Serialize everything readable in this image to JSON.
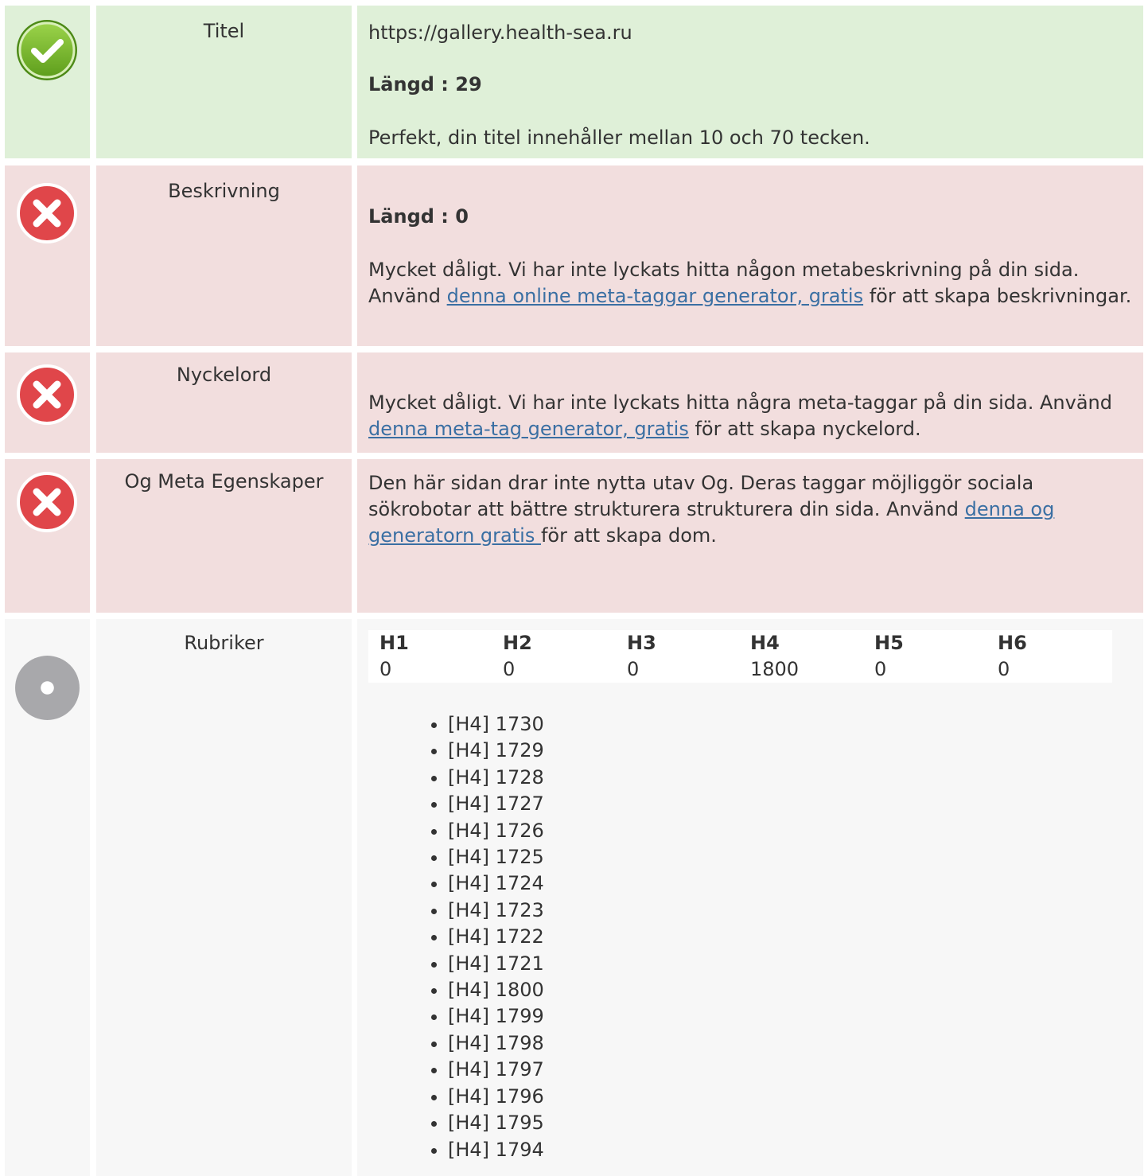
{
  "rows": {
    "title": {
      "label": "Titel",
      "value": "https://gallery.health-sea.ru",
      "length": "Längd : 29",
      "message": "Perfekt, din titel innehåller mellan 10 och 70 tecken."
    },
    "description": {
      "label": "Beskrivning",
      "length": "Längd : 0",
      "message_before": "Mycket dåligt. Vi har inte lyckats hitta någon metabeskrivning på din sida. Använd ",
      "link": "denna online meta-taggar generator, gratis",
      "message_after": " för att skapa beskrivningar."
    },
    "keywords": {
      "label": "Nyckelord",
      "message_before": "Mycket dåligt. Vi har inte lyckats hitta några meta-taggar på din sida. Använd ",
      "link": "denna meta-tag generator, gratis",
      "message_after": " för att skapa nyckelord."
    },
    "og": {
      "label": "Og Meta Egenskaper",
      "message_before": "Den här sidan drar inte nytta utav Og. Deras taggar möjliggör sociala sökrobotar att bättre strukturera strukturera din sida. Använd ",
      "link": "denna og generatorn gratis ",
      "message_after": " för att skapa dom."
    },
    "headings": {
      "label": "Rubriker",
      "table": [
        {
          "h": "H1",
          "v": "0"
        },
        {
          "h": "H2",
          "v": "0"
        },
        {
          "h": "H3",
          "v": "0"
        },
        {
          "h": "H4",
          "v": "1800"
        },
        {
          "h": "H5",
          "v": "0"
        },
        {
          "h": "H6",
          "v": "0"
        }
      ],
      "list": [
        "[H4] 1730",
        "[H4] 1729",
        "[H4] 1728",
        "[H4] 1727",
        "[H4] 1726",
        "[H4] 1725",
        "[H4] 1724",
        "[H4] 1723",
        "[H4] 1722",
        "[H4] 1721",
        "[H4] 1800",
        "[H4] 1799",
        "[H4] 1798",
        "[H4] 1797",
        "[H4] 1796",
        "[H4] 1795",
        "[H4] 1794"
      ]
    }
  },
  "icons": {
    "good": "check-circle-icon",
    "bad": "error-x-icon",
    "neutral": "info-dot-icon"
  },
  "colors": {
    "good_bg": "#dff0d8",
    "bad_bg": "#f2dede",
    "neutral_bg": "#f7f7f7",
    "link": "#3a6fa3"
  }
}
